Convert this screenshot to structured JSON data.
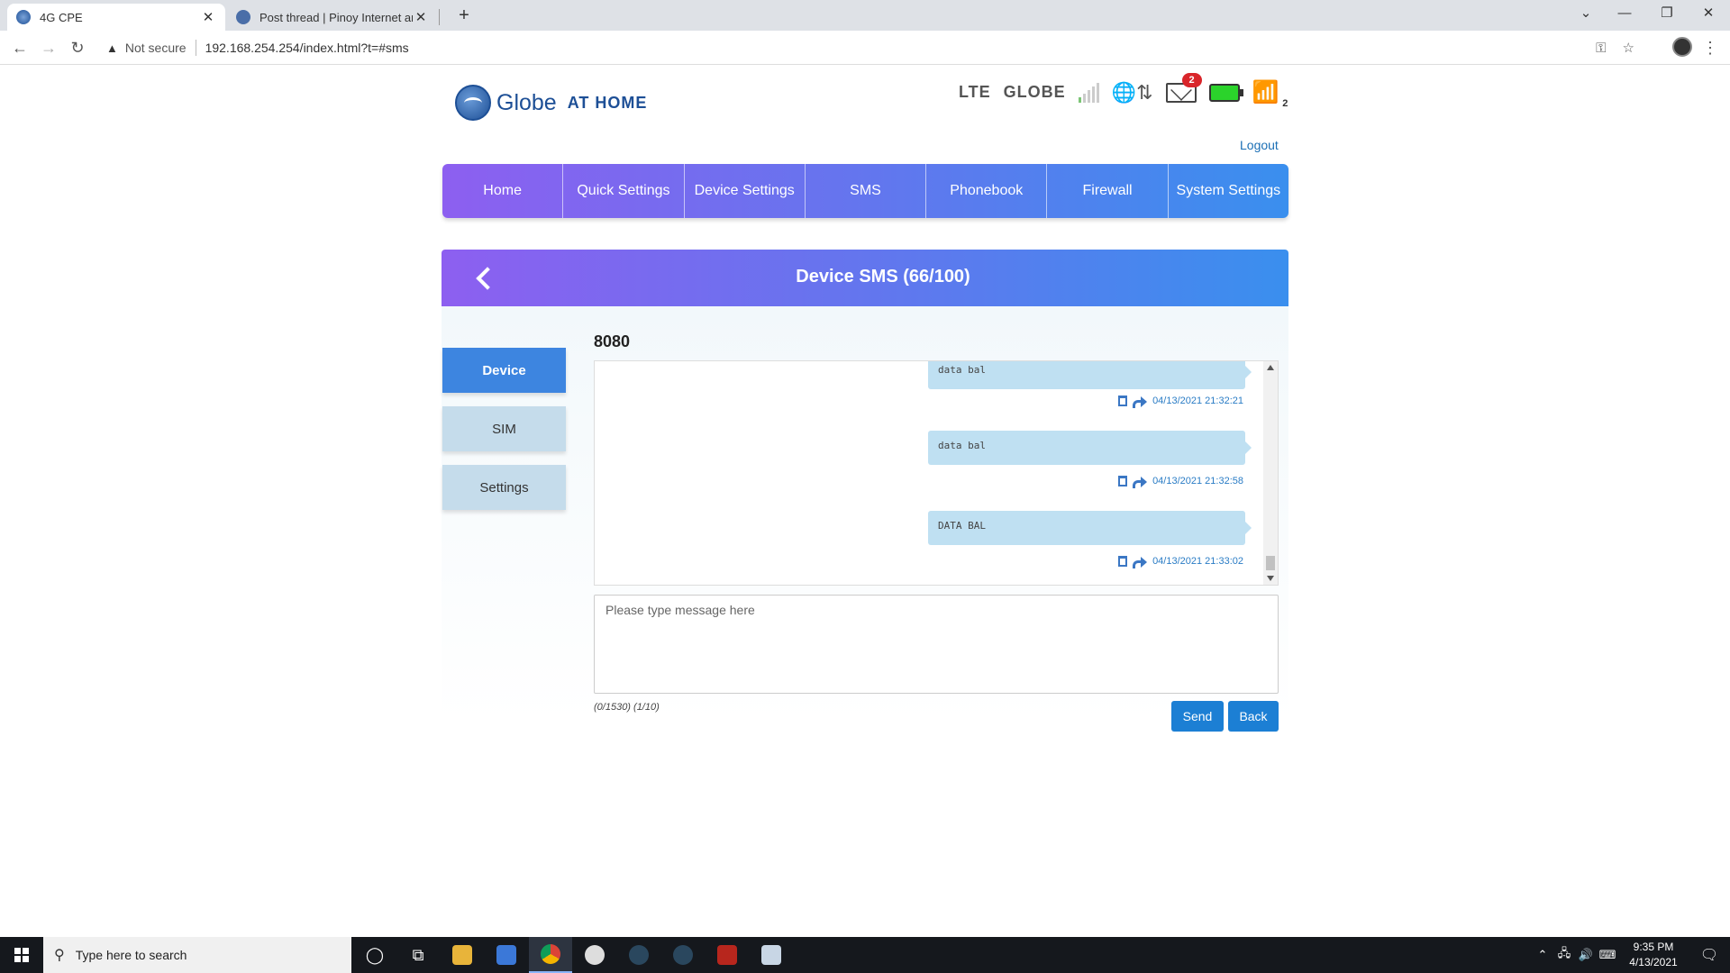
{
  "browser": {
    "tabs": [
      {
        "title": "4G CPE",
        "active": true
      },
      {
        "title": "Post thread | Pinoy Internet and T",
        "active": false
      }
    ],
    "new_tab": "+",
    "security_label": "Not secure",
    "url": "192.168.254.254/index.html?t=#sms"
  },
  "router": {
    "logo_text": "Globe",
    "logo_sub": "AT HOME",
    "network_type": "LTE",
    "carrier": "GLOBE",
    "signal_bars_active": 1,
    "signal_bars_total": 5,
    "unread_sms": "2",
    "wifi_clients": "2",
    "logout": "Logout",
    "nav": [
      "Home",
      "Quick Settings",
      "Device Settings",
      "SMS",
      "Phonebook",
      "Firewall",
      "System Settings"
    ],
    "panel_title": "Device SMS (66/100)",
    "side_nav": [
      "Device",
      "SIM",
      "Settings"
    ],
    "active_side": "Device",
    "contact": "8080",
    "messages": [
      {
        "text": "data bal",
        "time": "04/13/2021 21:32:21"
      },
      {
        "text": "data bal",
        "time": "04/13/2021 21:32:58"
      },
      {
        "text": "DATA BAL",
        "time": "04/13/2021 21:33:02"
      }
    ],
    "compose_placeholder": "Please type message here",
    "counter": "(0/1530) (1/10)",
    "send_label": "Send",
    "back_label": "Back"
  },
  "taskbar": {
    "search_placeholder": "Type here to search",
    "time": "9:35 PM",
    "date": "4/13/2021"
  },
  "colors": {
    "nav_gradient_start": "#8d5ff0",
    "nav_gradient_end": "#3a8fee",
    "bubble": "#bfe0f2",
    "accent_button": "#1c7fd4",
    "timestamp": "#2a7cc5"
  }
}
